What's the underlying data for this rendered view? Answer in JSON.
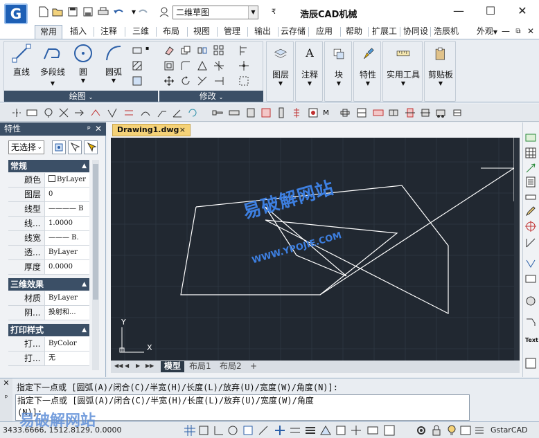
{
  "app": {
    "title": "浩辰CAD机械",
    "logo_letter": "G",
    "workspace": "二维草图"
  },
  "tabs": [
    "常用",
    "插入",
    "注释",
    "三维",
    "布局",
    "视图",
    "管理",
    "输出",
    "云存储",
    "应用",
    "帮助",
    "扩展工具",
    "协同设计",
    "浩辰机械"
  ],
  "tabs_right": {
    "label": "外观",
    "arrow": "▼"
  },
  "ribbon": {
    "draw_buttons": [
      "直线",
      "多段线",
      "圆",
      "圆弧"
    ],
    "draw_panel": "绘图",
    "modify_panel": "修改",
    "big_buttons": [
      "图层",
      "注释",
      "块",
      "特性",
      "实用工具",
      "剪贴板"
    ]
  },
  "properties": {
    "title": "特性",
    "selection": "无选择",
    "sections": {
      "general": "常规",
      "threed": "三维效果",
      "print": "打印样式"
    },
    "general_rows": [
      {
        "key": "颜色",
        "value": "ByLayer"
      },
      {
        "key": "图层",
        "value": "0"
      },
      {
        "key": "线型",
        "value": "———— B"
      },
      {
        "key": "线...",
        "value": "1.0000"
      },
      {
        "key": "线宽",
        "value": "——— B."
      },
      {
        "key": "透...",
        "value": "ByLayer"
      },
      {
        "key": "厚度",
        "value": "0.0000"
      }
    ],
    "threed_rows": [
      {
        "key": "材质",
        "value": "ByLayer"
      },
      {
        "key": "阴...",
        "value": "投射和..."
      }
    ],
    "print_rows": [
      {
        "key": "打...",
        "value": "ByColor"
      },
      {
        "key": "打...",
        "value": "无"
      }
    ]
  },
  "document": {
    "tab": "Drawing1.dwg",
    "close": "×",
    "layout_tabs": [
      "模型",
      "布局1",
      "布局2",
      "+"
    ],
    "active_layout": "模型"
  },
  "canvas": {
    "ucs_x": "X",
    "ucs_y": "Y",
    "background": "#212831",
    "stroke": "#ffffff"
  },
  "command": {
    "history": "指定下一点或 [圆弧(A)/闭合(C)/半宽(H)/长度(L)/放弃(U)/宽度(W)/角度(N)]:",
    "line1": "指定下一点或 [圆弧(A)/闭合(C)/半宽(H)/长度(L)/放弃(U)/宽度(W)/角度",
    "line2": "(N)]:"
  },
  "status": {
    "coords": "3433.6666, 1512.8129, 0.0000",
    "brand": "GstarCAD"
  },
  "watermark": {
    "cn": "易破解网站",
    "en": "WWW.YPOJIE.COM",
    "bottom": "易破解网站"
  },
  "colors": {
    "accent": "#1d5fb5",
    "panel_dark": "#3b4f66",
    "doc_tab": "#f5d277",
    "watermark": "#3d7fe0"
  }
}
